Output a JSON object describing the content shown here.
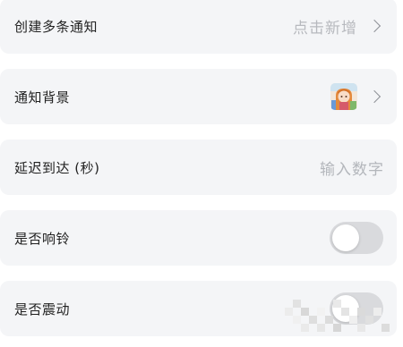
{
  "settings": {
    "rows": [
      {
        "label": "创建多条通知",
        "value": "点击新增"
      },
      {
        "label": "通知背景",
        "icon": "anime-character-thumbnail"
      },
      {
        "label": "延迟到达 (秒)",
        "placeholder": "输入数字"
      },
      {
        "label": "是否响铃",
        "toggle_on": false
      },
      {
        "label": "是否震动",
        "toggle_on": false
      }
    ]
  },
  "colors": {
    "card_bg": "#f4f5f7",
    "text": "#222222",
    "hint": "#b7b9be",
    "toggle_off": "#d9dadd"
  }
}
